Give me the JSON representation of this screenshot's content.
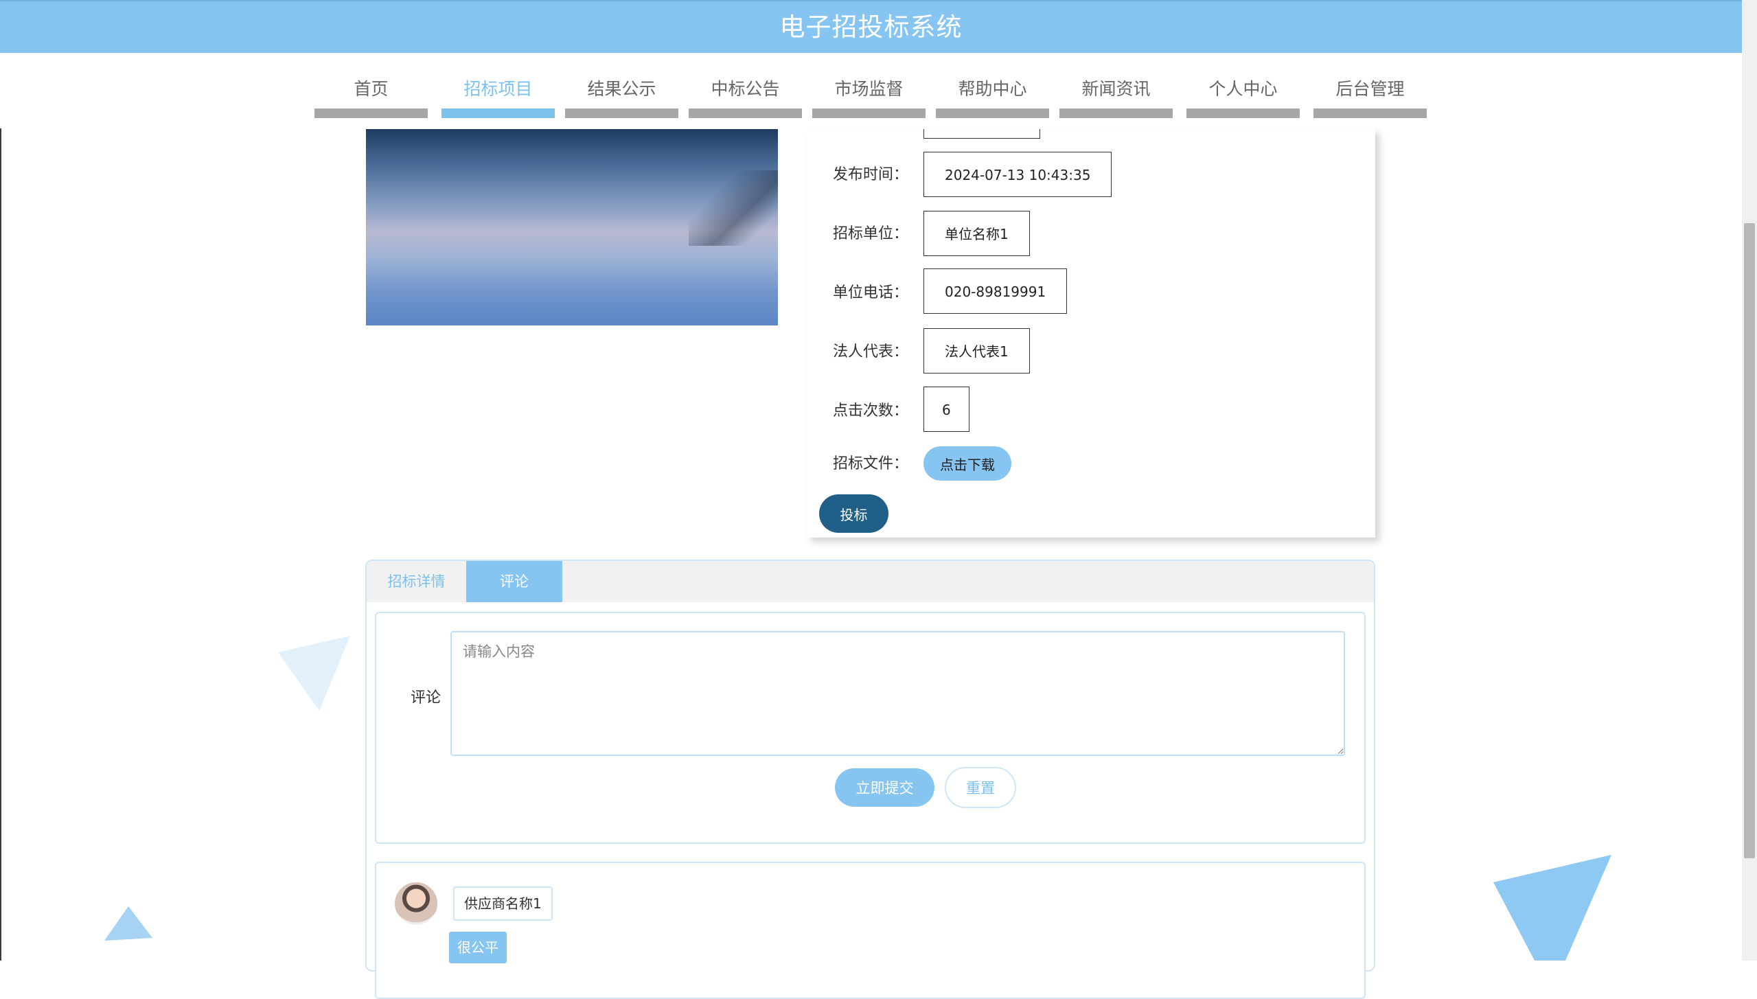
{
  "header": {
    "title": "电子招投标系统"
  },
  "nav": [
    {
      "label": "首页",
      "active": false
    },
    {
      "label": "招标项目",
      "active": true
    },
    {
      "label": "结果公示",
      "active": false
    },
    {
      "label": "中标公告",
      "active": false
    },
    {
      "label": "市场监督",
      "active": false
    },
    {
      "label": "帮助中心",
      "active": false
    },
    {
      "label": "新闻资讯",
      "active": false
    },
    {
      "label": "个人中心",
      "active": false
    },
    {
      "label": "后台管理",
      "active": false
    }
  ],
  "details": {
    "publish_time": {
      "label": "发布时间：",
      "value": "2024-07-13 10:43:35"
    },
    "unit": {
      "label": "招标单位：",
      "value": "单位名称1"
    },
    "phone": {
      "label": "单位电话：",
      "value": "020-89819991"
    },
    "legal_rep": {
      "label": "法人代表：",
      "value": "法人代表1"
    },
    "clicks": {
      "label": "点击次数：",
      "value": "6"
    },
    "file": {
      "label": "招标文件：",
      "button": "点击下载"
    },
    "bid_button": "投标"
  },
  "tabs": [
    {
      "label": "招标详情",
      "active": false
    },
    {
      "label": "评论",
      "active": true
    }
  ],
  "comment_form": {
    "label": "评论",
    "placeholder": "请输入内容",
    "submit": "立即提交",
    "reset": "重置"
  },
  "comments": [
    {
      "user": "供应商名称1",
      "text": "很公平"
    }
  ],
  "colors": {
    "primary": "#86c5f2",
    "accent_text": "#7cc0ee",
    "bid_button": "#1f5f88",
    "nav_underline": "#a6a6a6"
  }
}
